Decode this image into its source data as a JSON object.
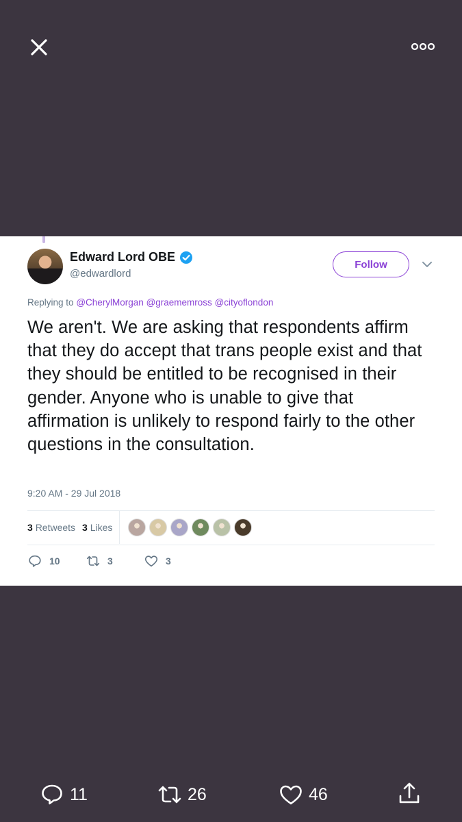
{
  "viewer": {
    "close_icon": "close-icon",
    "more_icon": "more-icon"
  },
  "tweet": {
    "display_name": "Edward Lord OBE",
    "handle": "@edwardlord",
    "follow_label": "Follow",
    "replying_prefix": "Replying to",
    "mentions": [
      "@CherylMorgan",
      "@graememross",
      "@cityoflondon"
    ],
    "text": "We aren't. We are asking that respondents affirm that they do accept that trans people exist and that they should be entitled to be recognised in their gender. Anyone who is unable to give that affirmation is unlikely to respond fairly to the other questions in the consultation.",
    "timestamp": "9:20 AM - 29 Jul 2018",
    "retweets_count": "3",
    "retweets_label": "Retweets",
    "likes_count": "3",
    "likes_label": "Likes",
    "liker_avatars": [
      "#b9a6a0",
      "#d8c9a5",
      "#a9a6c8",
      "#6f8a5e",
      "#b9c2a7",
      "#4a3b2a"
    ],
    "actions": {
      "replies": "10",
      "retweets": "3",
      "likes": "3"
    }
  },
  "bottom_bar": {
    "replies": "11",
    "retweets": "26",
    "likes": "46"
  },
  "colors": {
    "background": "#3c3540",
    "accent": "#8b42d6",
    "verified": "#1da1f2"
  }
}
